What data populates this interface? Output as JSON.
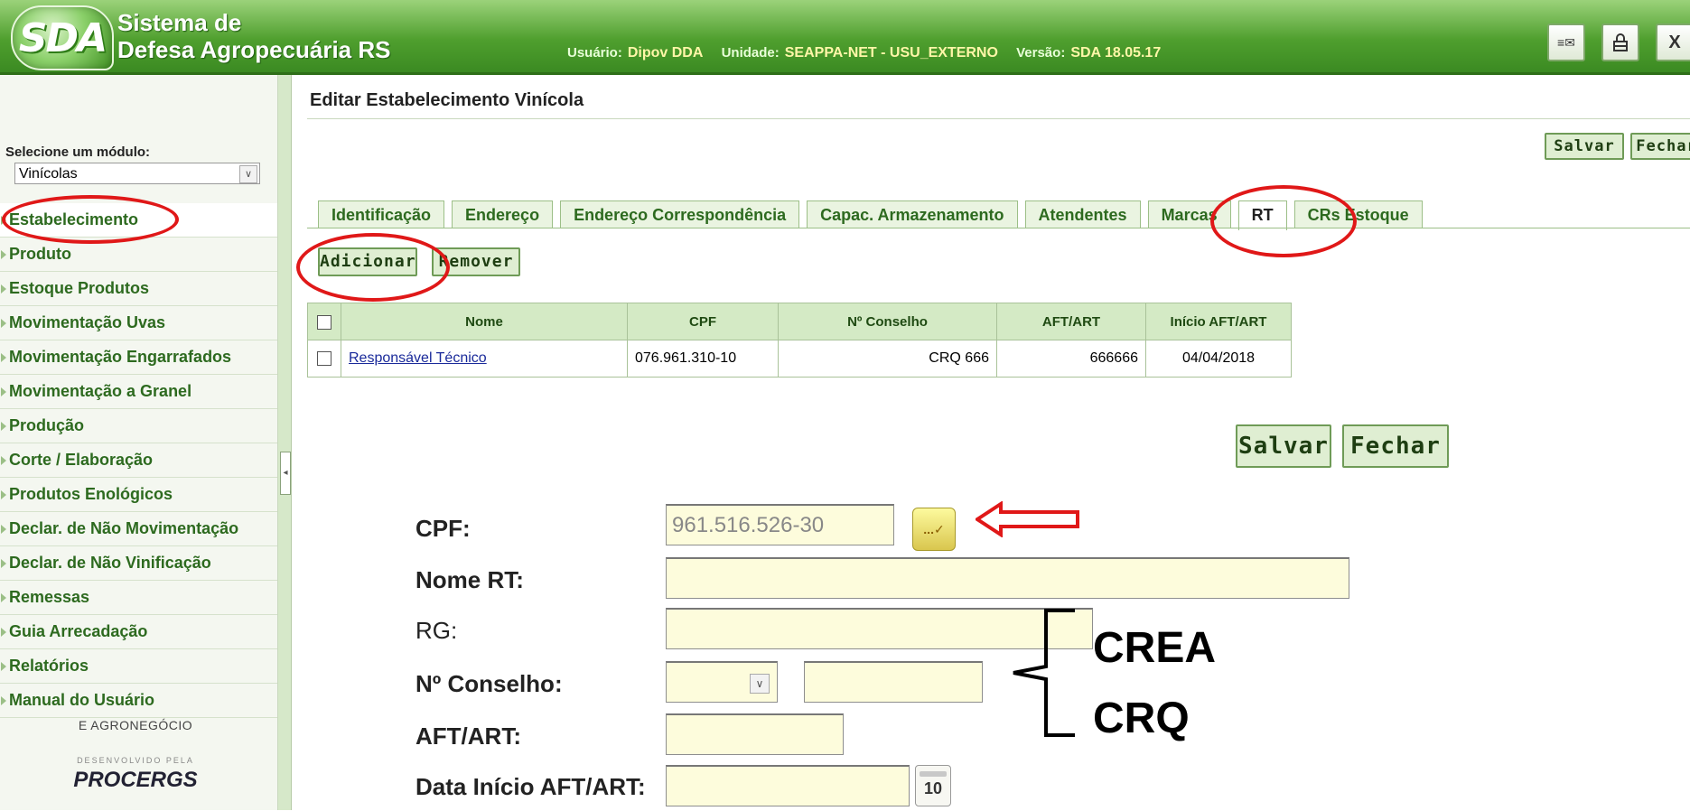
{
  "header": {
    "logo": "SDA",
    "title_line1": "Sistema de",
    "title_line2": "Defesa Agropecuária RS",
    "user_label": "Usuário:",
    "user_value": "Dipov DDA",
    "unit_label": "Unidade:",
    "unit_value": "SEAPPA-NET - USU_EXTERNO",
    "version_label": "Versão:",
    "version_value": "SDA 18.05.17",
    "buttons": [
      {
        "icon": "envelope-icon",
        "glyph": "≡✉"
      },
      {
        "icon": "lock-icon",
        "glyph": "🔒"
      },
      {
        "icon": "close-icon",
        "glyph": "X"
      }
    ]
  },
  "sidebar": {
    "module_label": "Selecione um módulo:",
    "module_value": "Vinícolas",
    "items": [
      {
        "label": "Estabelecimento"
      },
      {
        "label": "Produto"
      },
      {
        "label": "Estoque Produtos"
      },
      {
        "label": "Movimentação Uvas"
      },
      {
        "label": "Movimentação Engarrafados"
      },
      {
        "label": "Movimentação a Granel"
      },
      {
        "label": "Produção"
      },
      {
        "label": "Corte / Elaboração"
      },
      {
        "label": "Produtos Enológicos"
      },
      {
        "label": "Declar. de Não Movimentação"
      },
      {
        "label": "Declar. de Não Vinificação"
      },
      {
        "label": "Remessas"
      },
      {
        "label": "Guia Arrecadação"
      },
      {
        "label": "Relatórios"
      },
      {
        "label": "Manual do Usuário"
      }
    ],
    "footer_agro": "E AGRONEGÓCIO",
    "footer_dev": "DESENVOLVIDO PELA",
    "footer_brand": "PROCERGS"
  },
  "main": {
    "title": "Editar Estabelecimento Vinícola",
    "top_save": "Salvar",
    "top_close": "Fechar",
    "tabs": [
      {
        "label": "Identificação"
      },
      {
        "label": "Endereço"
      },
      {
        "label": "Endereço Correspondência"
      },
      {
        "label": "Capac. Armazenamento"
      },
      {
        "label": "Atendentes"
      },
      {
        "label": "Marcas"
      },
      {
        "label": "RT"
      },
      {
        "label": "CRs Estoque"
      }
    ],
    "add_button": "Adicionar",
    "remove_button": "Remover",
    "table": {
      "headers": [
        "Nome",
        "CPF",
        "Nº Conselho",
        "AFT/ART",
        "Início AFT/ART"
      ],
      "rows": [
        {
          "nome": "Responsável Técnico",
          "cpf": "076.961.310-10",
          "conselho": "CRQ 666",
          "aft": "666666",
          "inicio": "04/04/2018"
        }
      ]
    },
    "save_button": "Salvar",
    "close_button": "Fechar"
  },
  "form": {
    "cpf_label": "CPF:",
    "cpf_value": "961.516.526-30",
    "lookup_glyph": "...✓",
    "nome_label": "Nome RT:",
    "rg_label": "RG:",
    "conselho_label": "Nº Conselho:",
    "aft_label": "AFT/ART:",
    "data_label": "Data Início AFT/ART:",
    "calendar_day": "10"
  },
  "annotations": {
    "crea": "CREA",
    "crq": "CRQ",
    "color": "#e01818"
  }
}
